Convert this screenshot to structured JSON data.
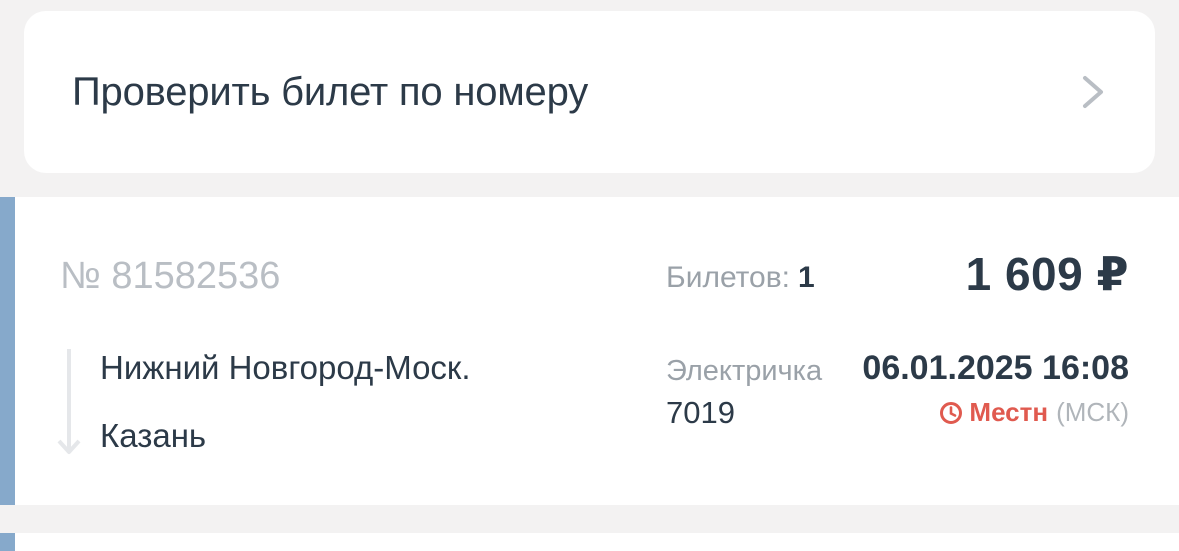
{
  "check_ticket": {
    "label": "Проверить билет по номеру",
    "icon": "chevron-right-icon"
  },
  "ticket": {
    "number": "№ 81582536",
    "tickets_label": "Билетов:",
    "tickets_count": "1",
    "price": "1 609 ₽",
    "from": "Нижний Новгород-Моск.",
    "to": "Казань",
    "train_type": "Электричка",
    "train_number": "7019",
    "datetime": "06.01.2025 16:08",
    "tz_local": "Местн",
    "tz_msk": "(МСК)",
    "accent_color": "#86a9cb",
    "local_color": "#e05a4f"
  }
}
